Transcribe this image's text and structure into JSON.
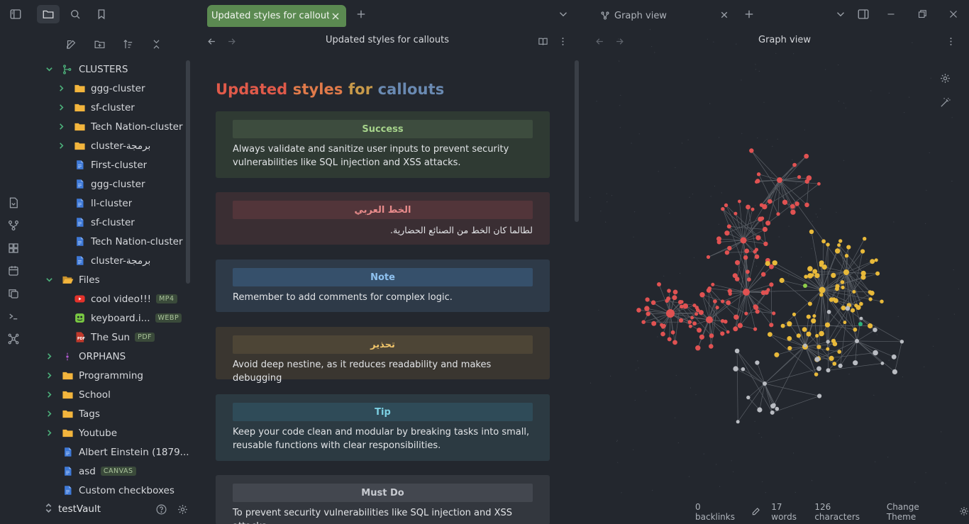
{
  "tabs": {
    "active_label": "Updated styles for callouts",
    "graph_label": "Graph view"
  },
  "sidebar": {
    "tree": [
      {
        "label": "CLUSTERS",
        "depth": 0,
        "chevron": "down",
        "icon": "tag-branch-icon"
      },
      {
        "label": "ggg-cluster",
        "depth": 1,
        "chevron": "right",
        "icon": "folder-icon"
      },
      {
        "label": "sf-cluster",
        "depth": 1,
        "chevron": "right",
        "icon": "folder-icon"
      },
      {
        "label": "Tech Nation-cluster",
        "depth": 1,
        "chevron": "right",
        "icon": "folder-icon"
      },
      {
        "label": "cluster-برمجة",
        "depth": 1,
        "chevron": "right",
        "icon": "folder-icon"
      },
      {
        "label": "First-cluster",
        "depth": 1,
        "chevron": "",
        "icon": "file-icon"
      },
      {
        "label": "ggg-cluster",
        "depth": 1,
        "chevron": "",
        "icon": "file-icon"
      },
      {
        "label": "ll-cluster",
        "depth": 1,
        "chevron": "",
        "icon": "file-icon"
      },
      {
        "label": "sf-cluster",
        "depth": 1,
        "chevron": "",
        "icon": "file-icon"
      },
      {
        "label": "Tech Nation-cluster",
        "depth": 1,
        "chevron": "",
        "icon": "file-icon"
      },
      {
        "label": "cluster-برمجة",
        "depth": 1,
        "chevron": "",
        "icon": "file-icon"
      },
      {
        "label": "Files",
        "depth": 0,
        "chevron": "down",
        "icon": "folder-open-icon"
      },
      {
        "label": "cool video!!!",
        "depth": 1,
        "chevron": "",
        "icon": "video-icon",
        "badge": "MP4"
      },
      {
        "label": "keyboard.i...",
        "depth": 1,
        "chevron": "",
        "icon": "image-icon",
        "badge": "WEBP"
      },
      {
        "label": "The Sun",
        "depth": 1,
        "chevron": "",
        "icon": "pdf-icon",
        "badge": "PDF"
      },
      {
        "label": "ORPHANS",
        "depth": 0,
        "chevron": "right",
        "icon": "orphan-icon"
      },
      {
        "label": "Programming",
        "depth": 0,
        "chevron": "right",
        "icon": "folder-icon"
      },
      {
        "label": "School",
        "depth": 0,
        "chevron": "right",
        "icon": "folder-icon"
      },
      {
        "label": "Tags",
        "depth": 0,
        "chevron": "right",
        "icon": "folder-icon"
      },
      {
        "label": "Youtube",
        "depth": 0,
        "chevron": "right",
        "icon": "folder-icon"
      },
      {
        "label": "Albert Einstein (1879...",
        "depth": 0,
        "chevron": "",
        "icon": "file-icon"
      },
      {
        "label": "asd",
        "depth": 0,
        "chevron": "",
        "icon": "file-icon",
        "badge": "CANVAS"
      },
      {
        "label": "Custom checkboxes",
        "depth": 0,
        "chevron": "",
        "icon": "file-icon"
      }
    ],
    "vault_name": "testVault"
  },
  "note": {
    "header_title": "Updated styles for callouts",
    "heading_words": [
      "Updated",
      "styles",
      "for",
      "callouts"
    ],
    "callouts": [
      {
        "title": "Success",
        "body": "Always validate and sanitize user inputs to prevent security vulnerabilities like SQL injection and XSS attacks.",
        "bg": "#2f3a33",
        "title_bg": "#3d4c3e",
        "title_color": "#a6d38b"
      },
      {
        "title": "الخط العربي",
        "body": "لطالما كان الخط من الصنائع الحضارية.",
        "bg": "#3a2e33",
        "title_bg": "#52353a",
        "title_color": "#e88b8b",
        "rtl": true
      },
      {
        "title": "Note",
        "body": "Remember to add comments for complex logic.",
        "bg": "#2e3a48",
        "title_bg": "#36506b",
        "title_color": "#8fc2f0"
      },
      {
        "title": "تحذير",
        "body": "Avoid deep nestine, as it reduces readability and makes debugging",
        "bg": "#3a3630",
        "title_bg": "#4d4536",
        "title_color": "#f0c56b"
      },
      {
        "title": "Tip",
        "body": "Keep your code clean and modular by breaking tasks into small, reusable functions with clear responsibilities.",
        "bg": "#2c3a42",
        "title_bg": "#2f4b58",
        "title_color": "#7cd0e2"
      },
      {
        "title": "Must Do",
        "body": "To prevent security vulnerabilities like SQL injection and XSS attacks.",
        "bg": "#33373e",
        "title_bg": "#43474f",
        "title_color": "#c7cad0"
      }
    ]
  },
  "graph": {
    "header_title": "Graph view",
    "colors": {
      "red": "#e05252",
      "yellow": "#e8b93a",
      "grey": "#b9bcc2",
      "green": "#8fcf4a",
      "teal": "#2eb27a",
      "edge": "#5a5f66"
    }
  },
  "status": {
    "backlinks": "0 backlinks",
    "words": "17 words",
    "characters": "126 characters",
    "theme_button": "Change Theme"
  },
  "colors": {
    "background": "#23272e",
    "active_tab": "#5b8a51",
    "folder_yellow": "#f3b53d",
    "file_blue": "#3f7ad8"
  }
}
